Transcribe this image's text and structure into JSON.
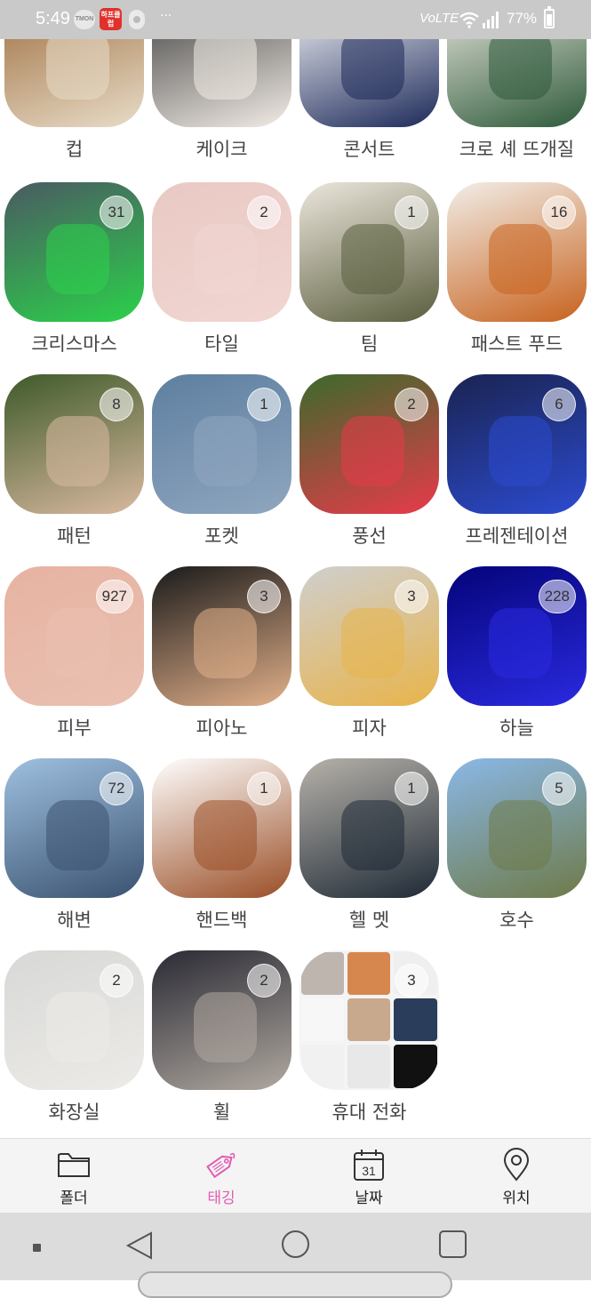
{
  "status_bar": {
    "time": "5:49",
    "app_icon_1": "TMON",
    "app_icon_2": "하프클럽",
    "more": "···",
    "network": "VoLTE",
    "battery_percent": "77%"
  },
  "rows": [
    {
      "tiles": [
        {
          "label": "컵",
          "count": "",
          "colors": [
            "#9b6a3a",
            "#e8dcc8"
          ]
        },
        {
          "label": "케이크",
          "count": "",
          "colors": [
            "#3a3a3a",
            "#f2ece6"
          ]
        },
        {
          "label": "콘서트",
          "count": "",
          "colors": [
            "#ffffff",
            "#1d2a5a"
          ]
        },
        {
          "label": "크로 셰 뜨개질",
          "count": "",
          "colors": [
            "#f0ece4",
            "#2e5a3a"
          ]
        }
      ]
    },
    {
      "tiles": [
        {
          "label": "크리스마스",
          "count": "31",
          "colors": [
            "#4a5a62",
            "#2bd14a"
          ]
        },
        {
          "label": "타일",
          "count": "2",
          "colors": [
            "#e9c9c4",
            "#f1d6d1"
          ]
        },
        {
          "label": "팀",
          "count": "1",
          "colors": [
            "#ece6dc",
            "#5a5e3e"
          ]
        },
        {
          "label": "패스트 푸드",
          "count": "16",
          "colors": [
            "#f1eee8",
            "#c8621e"
          ]
        }
      ]
    },
    {
      "tiles": [
        {
          "label": "패턴",
          "count": "8",
          "colors": [
            "#3e5a2a",
            "#d9b9a0"
          ]
        },
        {
          "label": "포켓",
          "count": "1",
          "colors": [
            "#5e7fa0",
            "#8fa6bf"
          ]
        },
        {
          "label": "풍선",
          "count": "2",
          "colors": [
            "#3b6a2c",
            "#e83a4a"
          ]
        },
        {
          "label": "프레젠테이션",
          "count": "6",
          "colors": [
            "#1a2350",
            "#2c4bd0"
          ]
        }
      ]
    },
    {
      "tiles": [
        {
          "label": "피부",
          "count": "927",
          "colors": [
            "#e7b3a2",
            "#e9c0b0"
          ]
        },
        {
          "label": "피아노",
          "count": "3",
          "colors": [
            "#1a1a1a",
            "#e2b08a"
          ]
        },
        {
          "label": "피자",
          "count": "3",
          "colors": [
            "#cfcfcf",
            "#e8b44a"
          ]
        },
        {
          "label": "하늘",
          "count": "228",
          "colors": [
            "#04047a",
            "#2a2ae0"
          ]
        }
      ]
    },
    {
      "tiles": [
        {
          "label": "해변",
          "count": "72",
          "colors": [
            "#9fc0e0",
            "#3a5270"
          ]
        },
        {
          "label": "핸드백",
          "count": "1",
          "colors": [
            "#ffffff",
            "#9a4e26"
          ]
        },
        {
          "label": "헬 멧",
          "count": "1",
          "colors": [
            "#b7b2aa",
            "#1f2a36"
          ]
        },
        {
          "label": "호수",
          "count": "5",
          "colors": [
            "#8ab8e8",
            "#6e7a48"
          ]
        }
      ]
    },
    {
      "tiles": [
        {
          "label": "화장실",
          "count": "2",
          "colors": [
            "#d8d8d6",
            "#ecebe8"
          ]
        },
        {
          "label": "휠",
          "count": "2",
          "colors": [
            "#2a2a34",
            "#b0a8a0"
          ]
        },
        {
          "label": "휴대 전화",
          "count": "3",
          "colors": [
            "#f4f4f4",
            "#c48a6a"
          ],
          "mosaic": true
        }
      ]
    }
  ],
  "bottom_nav": {
    "items": [
      {
        "label": "폴더",
        "icon": "folder-icon"
      },
      {
        "label": "태깅",
        "icon": "tag-icon",
        "active": true
      },
      {
        "label": "날짜",
        "icon": "calendar-icon",
        "calendar_day": "31"
      },
      {
        "label": "위치",
        "icon": "location-pin-icon"
      }
    ],
    "active_color": "#e25bb1"
  },
  "system_nav": {
    "buttons": [
      "menu",
      "back",
      "home",
      "recents"
    ]
  }
}
